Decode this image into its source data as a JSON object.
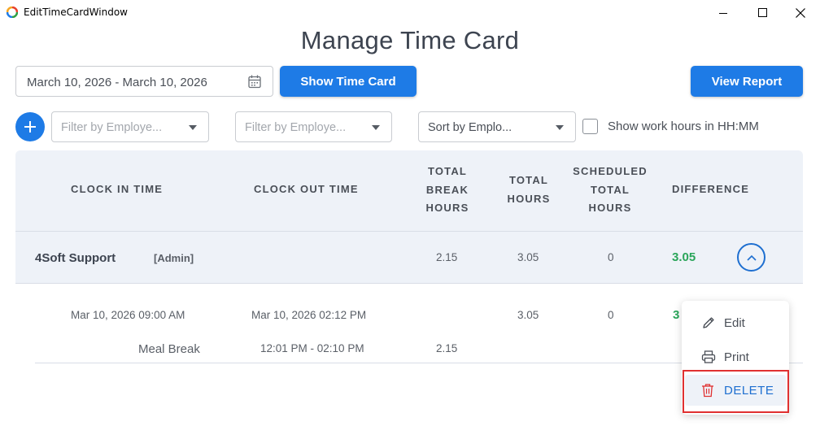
{
  "window": {
    "title": "EditTimeCardWindow",
    "controls": [
      "minimize",
      "maximize",
      "close"
    ]
  },
  "page_title": "Manage Time Card",
  "toolbar": {
    "date_range": "March 10, 2026 - March 10, 2026",
    "show_button": "Show Time Card",
    "report_button": "View Report"
  },
  "filters": {
    "employee_filter_1": "Filter by Employe...",
    "employee_filter_2": "Filter by Employe...",
    "sort": "Sort by Emplo...",
    "hhmm_label": "Show work hours in HH:MM",
    "hhmm_checked": false
  },
  "table": {
    "headers": {
      "clock_in": "CLOCK IN TIME",
      "clock_out": "CLOCK OUT TIME",
      "break_1": "TOTAL",
      "break_2": "BREAK",
      "break_3": "HOURS",
      "total_1": "TOTAL",
      "total_2": "HOURS",
      "sched_1": "SCHEDULED",
      "sched_2": "TOTAL",
      "sched_3": "HOURS",
      "difference": "DIFFERENCE"
    },
    "group": {
      "name": "4Soft Support",
      "role": "[Admin]",
      "break_hours": "2.15",
      "total_hours": "3.05",
      "scheduled": "0",
      "difference": "3.05"
    },
    "entry": {
      "clock_in": "Mar 10, 2026 09:00 AM",
      "clock_out": "Mar 10, 2026 02:12 PM",
      "total_hours": "3.05",
      "scheduled": "0",
      "difference_partial": "3"
    },
    "break": {
      "label": "Meal Break",
      "range": "12:01 PM - 02:10 PM",
      "hours": "2.15"
    }
  },
  "context_menu": {
    "edit": "Edit",
    "print": "Print",
    "delete": "DELETE"
  },
  "colors": {
    "primary": "#1e7be6",
    "difference_green": "#2aa55a",
    "header_bg": "#eef2f8",
    "highlight_red": "#e03030"
  }
}
